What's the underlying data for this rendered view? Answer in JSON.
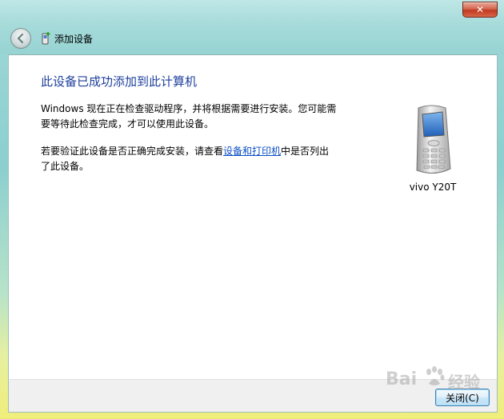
{
  "window": {
    "close_glyph": "✕",
    "nav_title": "添加设备"
  },
  "content": {
    "heading": "此设备已成功添加到此计算机",
    "para1": "Windows 现在正在检查驱动程序，并将根据需要进行安装。您可能需要等待此检查完成，才可以使用此设备。",
    "para2_prefix": "若要验证此设备是否正确完成安装，请查看",
    "para2_link": "设备和打印机",
    "para2_suffix": "中是否列出了此设备。",
    "device_name": "vivo Y20T"
  },
  "footer": {
    "close_label": "关闭(C)"
  },
  "watermark": {
    "text1": "Bai",
    "text2": "经验"
  },
  "colors": {
    "heading": "#1e3f9c",
    "link": "#0b4fc4",
    "close_red": "#c0391f"
  },
  "icons": {
    "back": "back-arrow-icon",
    "nav": "add-device-icon",
    "device": "mobile-phone-icon",
    "watermark": "baidu-paw-icon"
  }
}
